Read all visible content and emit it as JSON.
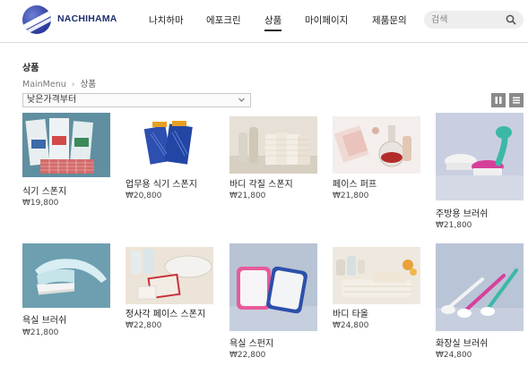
{
  "header": {
    "brand": "NACHIHAMA",
    "nav": [
      "나치하마",
      "에포크린",
      "상품",
      "마이페이지",
      "제품문의"
    ],
    "active_nav": "상품",
    "search_placeholder": "검색"
  },
  "page": {
    "title": "상품",
    "breadcrumb": [
      "MainMenu",
      "상품"
    ],
    "sort_selected": "낮은가격부터"
  },
  "products": [
    {
      "name": "식기 스폰지",
      "price": "₩19,800",
      "icon": "dish-sponge-pack-image"
    },
    {
      "name": "업무용 식기 스폰지",
      "price": "₩20,800",
      "icon": "blue-sponge-pack-image"
    },
    {
      "name": "바디 각질 스폰지",
      "price": "₩21,800",
      "icon": "body-sponge-image"
    },
    {
      "name": "페이스 퍼프",
      "price": "₩21,800",
      "icon": "face-puff-image"
    },
    {
      "name": "주방용 브러쉬",
      "price": "₩21,800",
      "icon": "kitchen-brush-image"
    },
    {
      "name": "욕실 브러쉬",
      "price": "₩21,800",
      "icon": "bath-brush-image"
    },
    {
      "name": "정사각 페이스 스폰지",
      "price": "₩22,800",
      "icon": "square-face-sponge-image"
    },
    {
      "name": "욕실 스펀지",
      "price": "₩22,800",
      "icon": "bath-sponge-image"
    },
    {
      "name": "바디 타올",
      "price": "₩24,800",
      "icon": "body-towel-image"
    },
    {
      "name": "화장실 브러쉬",
      "price": "₩24,800",
      "icon": "toilet-brush-image"
    }
  ],
  "colors": {
    "brand": "#1f2f6e",
    "view_button": "#8a8a8a"
  }
}
